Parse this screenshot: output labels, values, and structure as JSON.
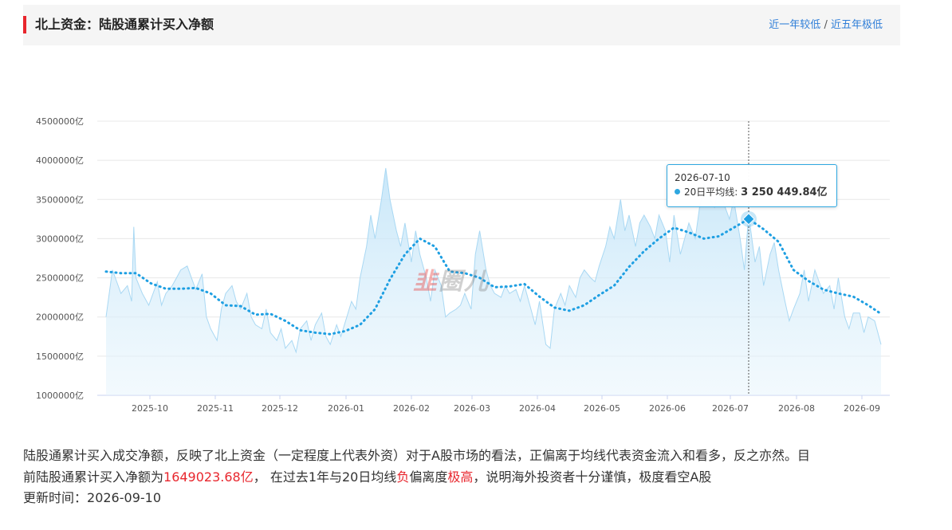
{
  "header": {
    "title": "北上资金：陆股通累计买入净额",
    "link_1year": "近一年较低",
    "separator": "/",
    "link_5year": "近五年极低"
  },
  "chart_data": {
    "type": "area",
    "y_tick_labels": [
      "1000000亿",
      "1500000亿",
      "2000000亿",
      "2500000亿",
      "3000000亿",
      "3500000亿",
      "4000000亿",
      "4500000亿"
    ],
    "ylim": [
      1000000,
      4500000
    ],
    "x_tick_labels": [
      "2025-10",
      "2025-11",
      "2025-12",
      "2026-01",
      "2026-02",
      "2026-03",
      "2026-04",
      "2026-05",
      "2026-06",
      "2026-07",
      "2026-08",
      "2026-09"
    ],
    "grid": true,
    "series": [
      {
        "name": "",
        "style": "area",
        "color": "#bfe3f8",
        "points": [
          [
            "2025-09-12",
            2000000
          ],
          [
            "2025-09-15",
            2600000
          ],
          [
            "2025-09-17",
            2450000
          ],
          [
            "2025-09-19",
            2300000
          ],
          [
            "2025-09-22",
            2400000
          ],
          [
            "2025-09-24",
            2200000
          ],
          [
            "2025-09-25",
            3150000
          ],
          [
            "2025-09-26",
            2500000
          ],
          [
            "2025-09-29",
            2300000
          ],
          [
            "2025-10-02",
            2150000
          ],
          [
            "2025-10-06",
            2450000
          ],
          [
            "2025-10-08",
            2150000
          ],
          [
            "2025-10-10",
            2300000
          ],
          [
            "2025-10-13",
            2400000
          ],
          [
            "2025-10-15",
            2500000
          ],
          [
            "2025-10-17",
            2600000
          ],
          [
            "2025-10-20",
            2650000
          ],
          [
            "2025-10-22",
            2500000
          ],
          [
            "2025-10-24",
            2350000
          ],
          [
            "2025-10-27",
            2550000
          ],
          [
            "2025-10-29",
            2000000
          ],
          [
            "2025-10-31",
            1850000
          ],
          [
            "2025-11-03",
            1700000
          ],
          [
            "2025-11-05",
            2100000
          ],
          [
            "2025-11-07",
            2300000
          ],
          [
            "2025-11-10",
            2400000
          ],
          [
            "2025-11-12",
            2200000
          ],
          [
            "2025-11-14",
            2100000
          ],
          [
            "2025-11-17",
            2300000
          ],
          [
            "2025-11-19",
            2000000
          ],
          [
            "2025-11-21",
            1900000
          ],
          [
            "2025-11-24",
            1850000
          ],
          [
            "2025-11-26",
            2100000
          ],
          [
            "2025-11-28",
            1800000
          ],
          [
            "2025-12-01",
            1700000
          ],
          [
            "2025-12-03",
            1850000
          ],
          [
            "2025-12-05",
            1600000
          ],
          [
            "2025-12-08",
            1700000
          ],
          [
            "2025-12-10",
            1550000
          ],
          [
            "2025-12-12",
            1850000
          ],
          [
            "2025-12-15",
            1950000
          ],
          [
            "2025-12-17",
            1700000
          ],
          [
            "2025-12-19",
            1900000
          ],
          [
            "2025-12-22",
            2050000
          ],
          [
            "2025-12-24",
            1750000
          ],
          [
            "2025-12-26",
            1650000
          ],
          [
            "2025-12-29",
            1900000
          ],
          [
            "2025-12-31",
            1750000
          ],
          [
            "2026-01-05",
            2200000
          ],
          [
            "2026-01-07",
            2100000
          ],
          [
            "2026-01-09",
            2500000
          ],
          [
            "2026-01-12",
            2900000
          ],
          [
            "2026-01-14",
            3300000
          ],
          [
            "2026-01-16",
            3000000
          ],
          [
            "2026-01-19",
            3500000
          ],
          [
            "2026-01-21",
            3900000
          ],
          [
            "2026-01-23",
            3500000
          ],
          [
            "2026-01-26",
            3100000
          ],
          [
            "2026-01-28",
            2900000
          ],
          [
            "2026-01-30",
            3200000
          ],
          [
            "2026-02-02",
            2700000
          ],
          [
            "2026-02-04",
            3100000
          ],
          [
            "2026-02-06",
            2800000
          ],
          [
            "2026-02-09",
            2500000
          ],
          [
            "2026-02-11",
            2200000
          ],
          [
            "2026-02-13",
            2600000
          ],
          [
            "2026-02-16",
            2400000
          ],
          [
            "2026-02-18",
            2000000
          ],
          [
            "2026-02-20",
            2050000
          ],
          [
            "2026-02-23",
            2100000
          ],
          [
            "2026-02-25",
            2150000
          ],
          [
            "2026-02-27",
            2300000
          ],
          [
            "2026-03-02",
            2100000
          ],
          [
            "2026-03-04",
            2800000
          ],
          [
            "2026-03-06",
            3100000
          ],
          [
            "2026-03-09",
            2600000
          ],
          [
            "2026-03-11",
            2400000
          ],
          [
            "2026-03-13",
            2300000
          ],
          [
            "2026-03-16",
            2250000
          ],
          [
            "2026-03-18",
            2400000
          ],
          [
            "2026-03-20",
            2300000
          ],
          [
            "2026-03-23",
            2350000
          ],
          [
            "2026-03-25",
            2200000
          ],
          [
            "2026-03-27",
            2400000
          ],
          [
            "2026-03-30",
            2100000
          ],
          [
            "2026-04-01",
            1900000
          ],
          [
            "2026-04-03",
            2200000
          ],
          [
            "2026-04-06",
            1650000
          ],
          [
            "2026-04-08",
            1600000
          ],
          [
            "2026-04-10",
            2100000
          ],
          [
            "2026-04-13",
            2300000
          ],
          [
            "2026-04-15",
            2150000
          ],
          [
            "2026-04-17",
            2400000
          ],
          [
            "2026-04-20",
            2250000
          ],
          [
            "2026-04-22",
            2500000
          ],
          [
            "2026-04-24",
            2600000
          ],
          [
            "2026-04-27",
            2500000
          ],
          [
            "2026-04-29",
            2450000
          ],
          [
            "2026-05-01",
            2650000
          ],
          [
            "2026-05-04",
            2900000
          ],
          [
            "2026-05-06",
            3150000
          ],
          [
            "2026-05-08",
            3000000
          ],
          [
            "2026-05-11",
            3500000
          ],
          [
            "2026-05-13",
            3100000
          ],
          [
            "2026-05-15",
            3300000
          ],
          [
            "2026-05-18",
            2900000
          ],
          [
            "2026-05-20",
            3200000
          ],
          [
            "2026-05-22",
            3300000
          ],
          [
            "2026-05-25",
            3150000
          ],
          [
            "2026-05-27",
            3000000
          ],
          [
            "2026-05-29",
            3300000
          ],
          [
            "2026-06-01",
            3100000
          ],
          [
            "2026-06-03",
            2700000
          ],
          [
            "2026-06-05",
            3300000
          ],
          [
            "2026-06-08",
            2800000
          ],
          [
            "2026-06-10",
            3000000
          ],
          [
            "2026-06-12",
            3200000
          ],
          [
            "2026-06-15",
            3000000
          ],
          [
            "2026-06-17",
            3400000
          ],
          [
            "2026-06-19",
            3700000
          ],
          [
            "2026-06-22",
            3500000
          ],
          [
            "2026-06-24",
            3400000
          ],
          [
            "2026-06-26",
            3700000
          ],
          [
            "2026-06-29",
            3400000
          ],
          [
            "2026-07-01",
            3250000
          ],
          [
            "2026-07-03",
            3500000
          ],
          [
            "2026-07-06",
            3000000
          ],
          [
            "2026-07-08",
            2600000
          ],
          [
            "2026-07-10",
            3300000
          ],
          [
            "2026-07-13",
            2700000
          ],
          [
            "2026-07-15",
            2900000
          ],
          [
            "2026-07-17",
            2400000
          ],
          [
            "2026-07-20",
            2800000
          ],
          [
            "2026-07-22",
            2950000
          ],
          [
            "2026-07-24",
            2600000
          ],
          [
            "2026-07-27",
            2200000
          ],
          [
            "2026-07-29",
            1950000
          ],
          [
            "2026-07-31",
            2100000
          ],
          [
            "2026-08-03",
            2300000
          ],
          [
            "2026-08-05",
            2600000
          ],
          [
            "2026-08-07",
            2200000
          ],
          [
            "2026-08-10",
            2600000
          ],
          [
            "2026-08-12",
            2450000
          ],
          [
            "2026-08-14",
            2300000
          ],
          [
            "2026-08-17",
            2400000
          ],
          [
            "2026-08-19",
            2100000
          ],
          [
            "2026-08-21",
            2500000
          ],
          [
            "2026-08-24",
            2000000
          ],
          [
            "2026-08-26",
            1850000
          ],
          [
            "2026-08-28",
            2050000
          ],
          [
            "2026-08-31",
            2050000
          ],
          [
            "2026-09-02",
            1800000
          ],
          [
            "2026-09-04",
            2000000
          ],
          [
            "2026-09-07",
            1950000
          ],
          [
            "2026-09-10",
            1649024
          ]
        ]
      },
      {
        "name": "20日平均线",
        "style": "dotted-line",
        "color": "#1e9fe2",
        "points": [
          [
            "2025-09-12",
            2580000
          ],
          [
            "2025-09-19",
            2560000
          ],
          [
            "2025-09-26",
            2560000
          ],
          [
            "2025-10-03",
            2430000
          ],
          [
            "2025-10-10",
            2360000
          ],
          [
            "2025-10-17",
            2360000
          ],
          [
            "2025-10-24",
            2370000
          ],
          [
            "2025-10-31",
            2300000
          ],
          [
            "2025-11-07",
            2150000
          ],
          [
            "2025-11-14",
            2140000
          ],
          [
            "2025-11-21",
            2030000
          ],
          [
            "2025-11-28",
            2040000
          ],
          [
            "2025-12-05",
            1950000
          ],
          [
            "2025-12-12",
            1830000
          ],
          [
            "2025-12-19",
            1800000
          ],
          [
            "2025-12-26",
            1780000
          ],
          [
            "2026-01-02",
            1820000
          ],
          [
            "2026-01-09",
            1900000
          ],
          [
            "2026-01-16",
            2100000
          ],
          [
            "2026-01-23",
            2480000
          ],
          [
            "2026-01-30",
            2800000
          ],
          [
            "2026-02-06",
            3000000
          ],
          [
            "2026-02-13",
            2900000
          ],
          [
            "2026-02-20",
            2580000
          ],
          [
            "2026-02-27",
            2560000
          ],
          [
            "2026-03-06",
            2500000
          ],
          [
            "2026-03-13",
            2380000
          ],
          [
            "2026-03-20",
            2390000
          ],
          [
            "2026-03-27",
            2420000
          ],
          [
            "2026-04-03",
            2260000
          ],
          [
            "2026-04-10",
            2120000
          ],
          [
            "2026-04-17",
            2080000
          ],
          [
            "2026-04-24",
            2150000
          ],
          [
            "2026-05-01",
            2280000
          ],
          [
            "2026-05-08",
            2400000
          ],
          [
            "2026-05-15",
            2640000
          ],
          [
            "2026-05-22",
            2840000
          ],
          [
            "2026-05-29",
            3000000
          ],
          [
            "2026-06-05",
            3140000
          ],
          [
            "2026-06-12",
            3080000
          ],
          [
            "2026-06-19",
            3000000
          ],
          [
            "2026-06-26",
            3030000
          ],
          [
            "2026-07-03",
            3140000
          ],
          [
            "2026-07-10",
            3250450
          ],
          [
            "2026-07-17",
            3120000
          ],
          [
            "2026-07-24",
            2960000
          ],
          [
            "2026-07-31",
            2600000
          ],
          [
            "2026-08-07",
            2460000
          ],
          [
            "2026-08-14",
            2350000
          ],
          [
            "2026-08-21",
            2300000
          ],
          [
            "2026-08-28",
            2260000
          ],
          [
            "2026-09-04",
            2150000
          ],
          [
            "2026-09-10",
            2040000
          ]
        ]
      }
    ],
    "x_range": [
      "2025-09-12",
      "2026-09-10"
    ],
    "highlight": {
      "date": "2026-07-10",
      "value": 3250449.84
    }
  },
  "tooltip": {
    "date": "2026-07-10",
    "series_name": "20日平均线:",
    "value": "3 250 449.84亿"
  },
  "watermark": {
    "part1": "韭",
    "part2": "圈儿"
  },
  "description": {
    "line_1": "陆股通累计买入成交净额，反映了北上资金（一定程度上代表外资）对于A股市场的看法，正偏离于均线代表资金流入和看多，反之亦然。目",
    "line_2_prefix": "前陆股通累计买入净额为",
    "current_value": "1649023.68亿",
    "line_2_mid": "，  在过去1年与20日均线",
    "deviation_direction": "负",
    "line_2_mid2": "偏离度",
    "deviation_level": "极高",
    "line_2_suffix": "，说明海外投资者十分谨慎，极度看空A股"
  },
  "update": {
    "label": "更新时间：",
    "date": "2026-09-10"
  }
}
